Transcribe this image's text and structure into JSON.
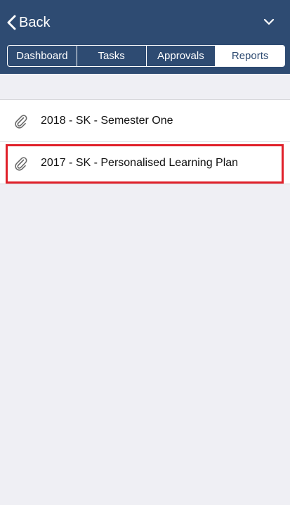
{
  "header": {
    "back_label": "Back",
    "back_icon": "chevron-left-icon",
    "menu_icon": "chevron-down-icon"
  },
  "tabs": [
    {
      "label": "Dashboard",
      "active": false
    },
    {
      "label": "Tasks",
      "active": false
    },
    {
      "label": "Approvals",
      "active": false
    },
    {
      "label": "Reports",
      "active": true
    }
  ],
  "reports": [
    {
      "title": "2018 - SK - Semester One",
      "icon": "paperclip-icon"
    },
    {
      "title": "2017 - SK - Personalised Learning Plan",
      "icon": "paperclip-icon",
      "highlighted": true
    }
  ],
  "colors": {
    "header_bg": "#2e4b72",
    "background": "#efeff4",
    "highlight": "#e0202a"
  }
}
